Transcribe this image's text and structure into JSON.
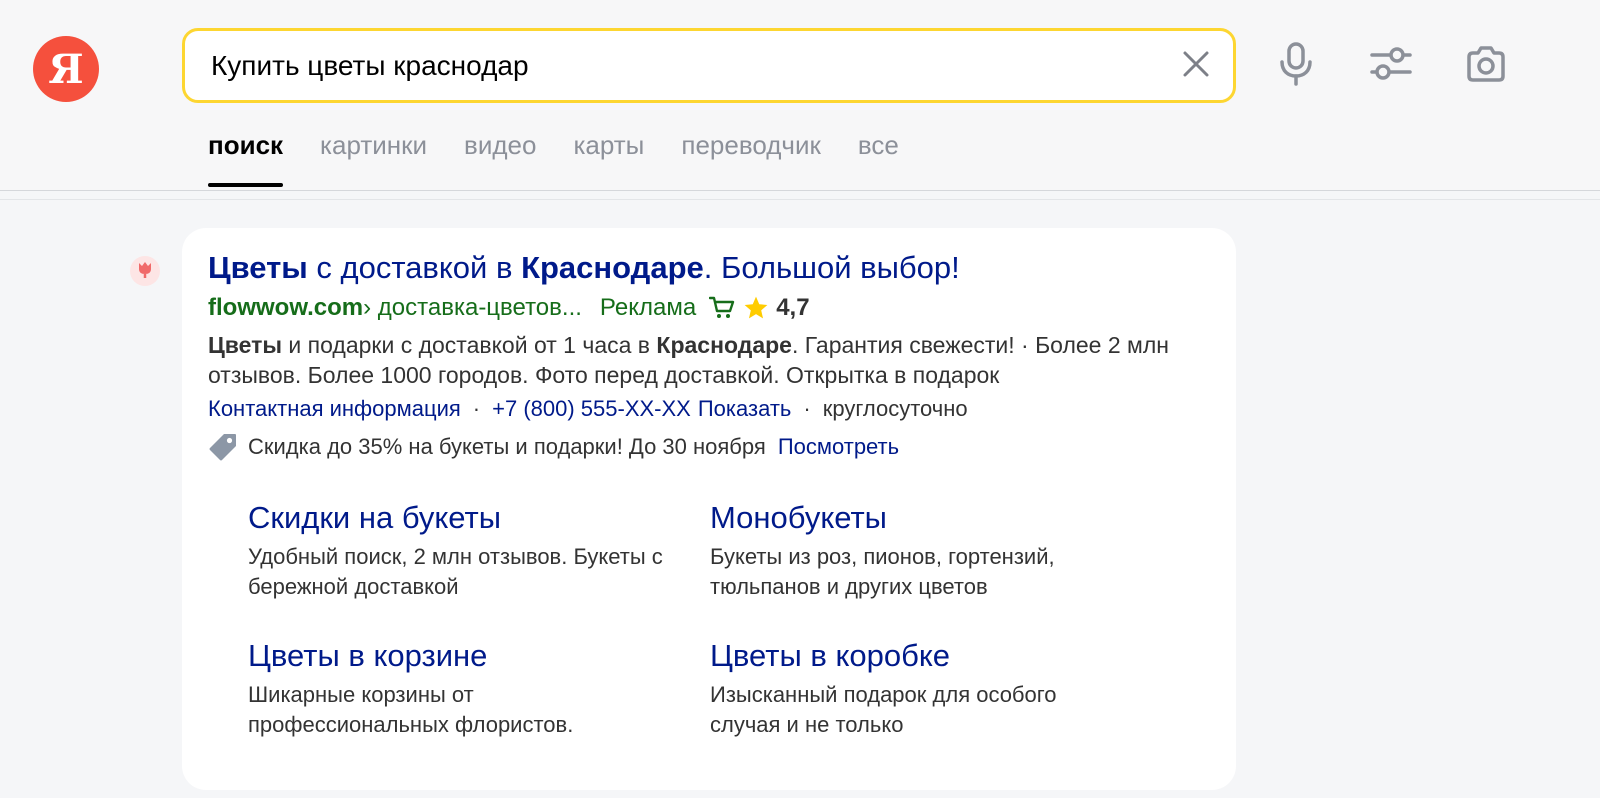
{
  "header": {
    "logo_letter": "Я",
    "search": {
      "value": "Купить цветы краснодар",
      "placeholder": ""
    },
    "tabs": [
      {
        "label": "поиск",
        "active": true
      },
      {
        "label": "картинки",
        "active": false
      },
      {
        "label": "видео",
        "active": false
      },
      {
        "label": "карты",
        "active": false
      },
      {
        "label": "переводчик",
        "active": false
      },
      {
        "label": "все",
        "active": false
      }
    ]
  },
  "icons": {
    "clear": "close-icon",
    "voice": "microphone-icon",
    "filters": "filters-icon",
    "image_search": "camera-icon",
    "favicon": "tulip-icon",
    "cart": "cart-icon",
    "star": "star-icon",
    "tag": "tag-icon"
  },
  "colors": {
    "accent_yellow": "#fdd631",
    "logo_red": "#f5503d",
    "link_blue": "#001a8a",
    "url_green": "#166d1a",
    "star_gold": "#ffcc00"
  },
  "result": {
    "title": {
      "part1": "Цветы",
      "part2": " с доставкой в ",
      "part3": "Краснодаре",
      "part4": ". Большой выбор!"
    },
    "domain": "flowwow.com",
    "path": " › доставка-цветов...",
    "ad_label": "Реклама",
    "rating": "4,7",
    "snippet": {
      "b1": "Цветы",
      "t1": " и подарки с доставкой от 1 часа в ",
      "b2": "Краснодаре",
      "t2": ". Гарантия свежести! · Более 2 млн отзывов. Более 1000 городов. Фото перед доставкой. Открытка в подарок"
    },
    "contacts": {
      "contact_link": "Контактная информация",
      "phone": "+7 (800) 555-XX-XX",
      "show_link": "Показать",
      "hours": "круглосуточно",
      "separator": "·"
    },
    "promo": {
      "text": "Скидка до 35% на букеты и подарки! До 30 ноября",
      "link": "Посмотреть"
    },
    "sitelinks": [
      {
        "title": "Скидки на букеты",
        "desc": "Удобный поиск, 2 млн отзывов. Букеты с бережной доставкой"
      },
      {
        "title": "Монобукеты",
        "desc": "Букеты из роз, пионов, гортензий, тюльпанов и других цветов"
      },
      {
        "title": "Цветы в корзине",
        "desc": "Шикарные корзины от профессиональных флористов."
      },
      {
        "title": "Цветы в коробке",
        "desc": "Изысканный подарок для особого случая и не только"
      }
    ]
  }
}
